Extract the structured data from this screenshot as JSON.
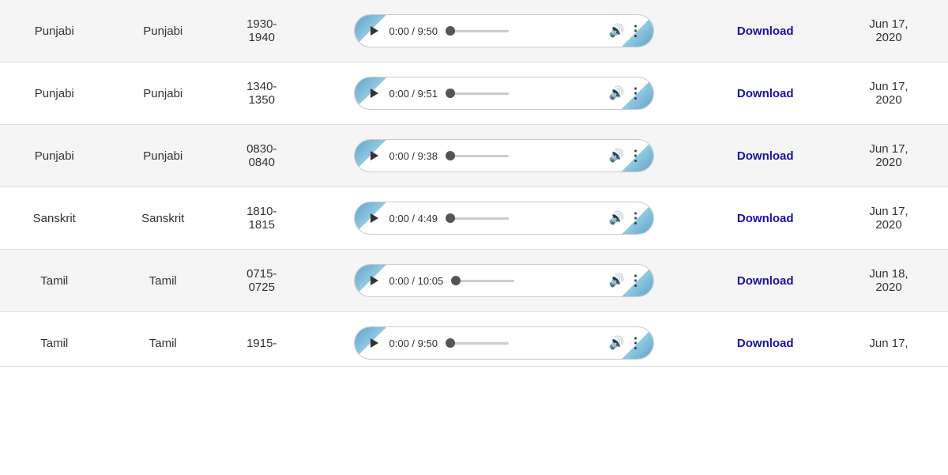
{
  "rows": [
    {
      "id": 0,
      "lang1": "Punjabi",
      "lang2": "Punjabi",
      "timeRange": "1930-\n1940",
      "duration": "0:00 / 9:50",
      "download": "Download",
      "date": "Jun 17,\n2020",
      "bg": "even"
    },
    {
      "id": 1,
      "lang1": "Punjabi",
      "lang2": "Punjabi",
      "timeRange": "1340-\n1350",
      "duration": "0:00 / 9:51",
      "download": "Download",
      "date": "Jun 17,\n2020",
      "bg": "odd"
    },
    {
      "id": 2,
      "lang1": "Punjabi",
      "lang2": "Punjabi",
      "timeRange": "0830-\n0840",
      "duration": "0:00 / 9:38",
      "download": "Download",
      "date": "Jun 17,\n2020",
      "bg": "even"
    },
    {
      "id": 3,
      "lang1": "Sanskrit",
      "lang2": "Sanskrit",
      "timeRange": "1810-\n1815",
      "duration": "0:00 / 4:49",
      "download": "Download",
      "date": "Jun 17,\n2020",
      "bg": "odd"
    },
    {
      "id": 4,
      "lang1": "Tamil",
      "lang2": "Tamil",
      "timeRange": "0715-\n0725",
      "duration": "0:00 / 10:05",
      "download": "Download",
      "date": "Jun 18,\n2020",
      "bg": "even"
    },
    {
      "id": 5,
      "lang1": "Tamil",
      "lang2": "Tamil",
      "timeRange": "1915-",
      "duration": "0:00 / 9:50",
      "download": "Download",
      "date": "Jun 17,",
      "bg": "odd",
      "partial": true
    }
  ]
}
